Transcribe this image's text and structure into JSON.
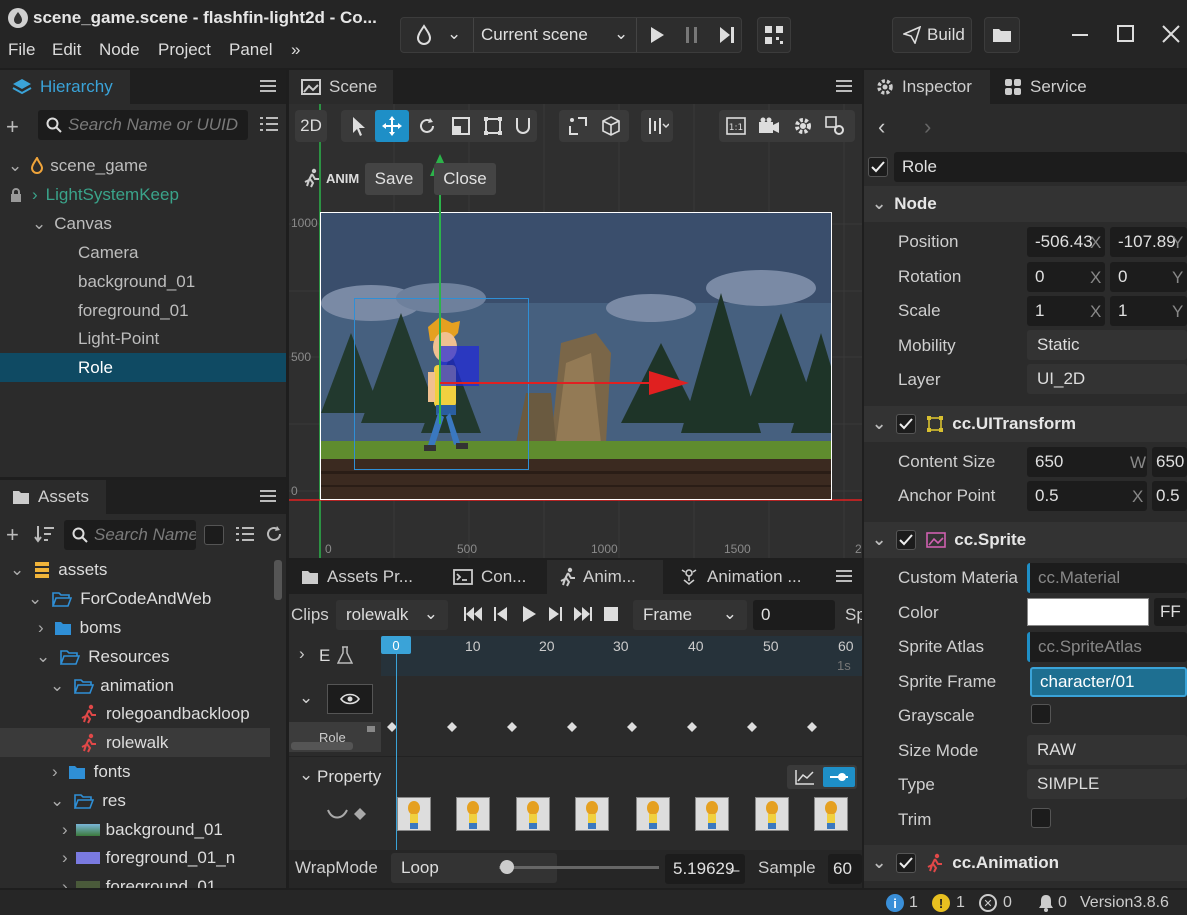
{
  "window": {
    "title": "scene_game.scene - flashfin-light2d - Co..."
  },
  "menu": [
    "File",
    "Edit",
    "Node",
    "Project",
    "Panel"
  ],
  "toolbar": {
    "scene_select": "Current scene",
    "build_label": "Build"
  },
  "hierarchy": {
    "tab": "Hierarchy",
    "search_placeholder": "Search Name or UUID",
    "items": [
      {
        "label": "scene_game"
      },
      {
        "label": "LightSystemKeep"
      },
      {
        "label": "Canvas"
      },
      {
        "label": "Camera"
      },
      {
        "label": "background_01"
      },
      {
        "label": "foreground_01"
      },
      {
        "label": "Light-Point"
      },
      {
        "label": "Role"
      }
    ]
  },
  "assets": {
    "tab": "Assets",
    "search_placeholder": "Search Name",
    "items": [
      {
        "label": "assets"
      },
      {
        "label": "ForCodeAndWeb"
      },
      {
        "label": "boms"
      },
      {
        "label": "Resources"
      },
      {
        "label": "animation"
      },
      {
        "label": "rolegoandbackloop"
      },
      {
        "label": "rolewalk"
      },
      {
        "label": "fonts"
      },
      {
        "label": "res"
      },
      {
        "label": "background_01"
      },
      {
        "label": "foreground_01_n"
      },
      {
        "label": "foreground_01"
      }
    ]
  },
  "scene": {
    "tab": "Scene",
    "mode_2d": "2D",
    "anim_label": "ANIM",
    "save_label": "Save",
    "close_label": "Close",
    "y_ticks": [
      "1000",
      "500",
      "0"
    ],
    "x_ticks": [
      "0",
      "500",
      "1000",
      "1500",
      "2"
    ]
  },
  "bottom_tabs": [
    "Assets Pr...",
    "Con...",
    "Anim...",
    "Animation ..."
  ],
  "animation": {
    "clips_label": "Clips",
    "clip_value": "rolewalk",
    "frame_mode": "Frame",
    "frame_value": "0",
    "sp_label": "Sp",
    "ruler": [
      "0",
      "10",
      "20",
      "30",
      "40",
      "50",
      "60"
    ],
    "ruler_sec": "1s",
    "track_label": "E",
    "node_label": "Role",
    "property_label": "Property",
    "wrapmode_label": "WrapMode",
    "wrapmode_value": "Loop",
    "duration_value": "5.19629̶",
    "sample_label": "Sample",
    "sample_value": "60"
  },
  "inspector": {
    "tab": "Inspector",
    "service_tab": "Service",
    "node_name": "Role",
    "node_section": "Node",
    "position": {
      "label": "Position",
      "x": "-506.43",
      "y": "-107.89"
    },
    "rotation": {
      "label": "Rotation",
      "x": "0",
      "y": "0"
    },
    "scale": {
      "label": "Scale",
      "x": "1",
      "y": "1"
    },
    "mobility": {
      "label": "Mobility",
      "value": "Static"
    },
    "layer": {
      "label": "Layer",
      "value": "UI_2D"
    },
    "uitransform": {
      "title": "cc.UITransform",
      "content_size_label": "Content Size",
      "w": "650",
      "h": "650",
      "anchor_label": "Anchor Point",
      "ax": "0.5",
      "ay": "0.5"
    },
    "sprite": {
      "title": "cc.Sprite",
      "custom_material_label": "Custom Materia",
      "custom_material_value": "cc.Material",
      "color_label": "Color",
      "color_hex": "FF",
      "atlas_label": "Sprite Atlas",
      "atlas_value": "cc.SpriteAtlas",
      "frame_label": "Sprite Frame",
      "frame_value": "character/01",
      "grayscale_label": "Grayscale",
      "size_mode_label": "Size Mode",
      "size_mode_value": "RAW",
      "type_label": "Type",
      "type_value": "SIMPLE",
      "trim_label": "Trim"
    },
    "animation_title": "cc.Animation"
  },
  "status": {
    "info": "1",
    "warn": "1",
    "error": "0",
    "notify": "0",
    "version": "Version3.8.6"
  },
  "colors": {
    "accent": "#1e8fc7",
    "selected": "#0f4a63",
    "green": "#2cb34a",
    "red": "#e02020"
  }
}
